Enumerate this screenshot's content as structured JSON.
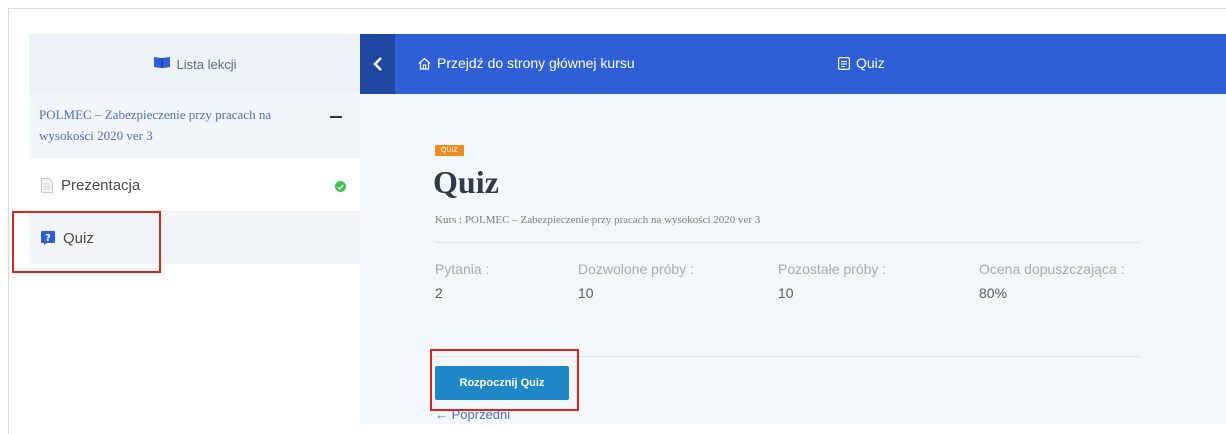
{
  "sidebar": {
    "header_label": "Lista lekcji",
    "course_title": "POLMEC – Zabezpieczenie przy pracach na wysokości 2020 ver 3",
    "lessons": [
      {
        "label": "Prezentacja",
        "completed": true,
        "icon": "document-icon"
      },
      {
        "label": "Quiz",
        "completed": false,
        "icon": "quiz-icon"
      }
    ]
  },
  "topbar": {
    "home_label": "Przejdź do strony głównej kursu",
    "quiz_label": "Quiz"
  },
  "main": {
    "badge": "QUIZ",
    "title": "Quiz",
    "course_info": "Kurs : POLMEC – Zabezpieczenie przy pracach na wysokości 2020 ver 3",
    "stats": [
      {
        "label": "Pytania :",
        "value": "2"
      },
      {
        "label": "Dozwolone próby :",
        "value": "10"
      },
      {
        "label": "Pozostałe próby :",
        "value": "10"
      },
      {
        "label": "Ocena dopuszczająca :",
        "value": "80%"
      }
    ],
    "start_button": "Rozpocznij Quiz",
    "prev_link": "← Poprzedni"
  },
  "colors": {
    "topbar": "#2f5fd6",
    "back_button": "#1f479f",
    "start_button": "#1f86c7",
    "badge": "#f08a24",
    "highlight": "#e2231a"
  }
}
